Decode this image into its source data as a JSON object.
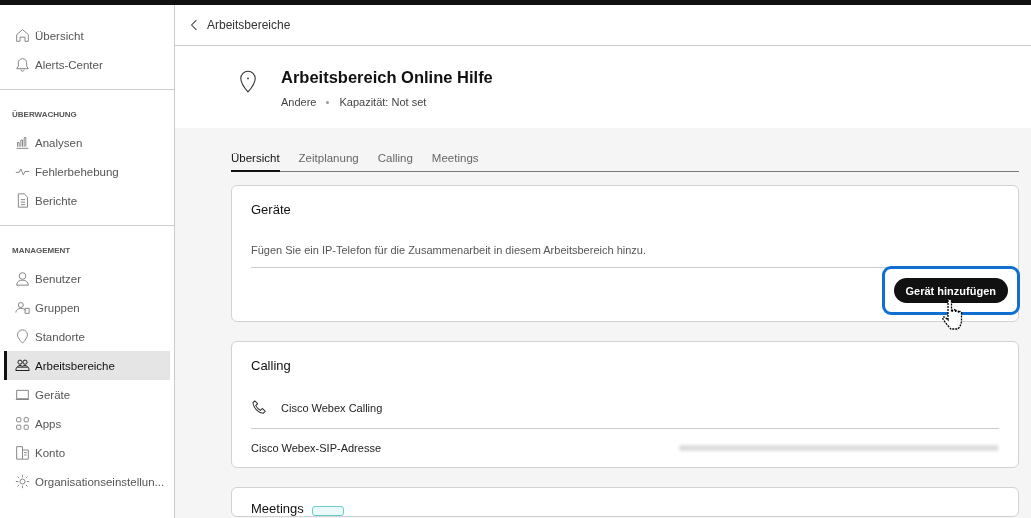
{
  "sidebar": {
    "sections": [
      {
        "items": [
          {
            "label": "Übersicht",
            "selected": false
          },
          {
            "label": "Alerts-Center",
            "selected": false
          }
        ]
      },
      {
        "heading": "ÜBERWACHUNG",
        "items": [
          {
            "label": "Analysen",
            "selected": false
          },
          {
            "label": "Fehlerbehebung",
            "selected": false
          },
          {
            "label": "Berichte",
            "selected": false
          }
        ]
      },
      {
        "heading": "MANAGEMENT",
        "items": [
          {
            "label": "Benutzer",
            "selected": false
          },
          {
            "label": "Gruppen",
            "selected": false
          },
          {
            "label": "Standorte",
            "selected": false
          },
          {
            "label": "Arbeitsbereiche",
            "selected": true
          },
          {
            "label": "Geräte",
            "selected": false
          },
          {
            "label": "Apps",
            "selected": false
          },
          {
            "label": "Konto",
            "selected": false
          },
          {
            "label": "Organisationseinstellun...",
            "selected": false
          }
        ]
      }
    ]
  },
  "breadcrumb": {
    "back_label": "Arbeitsbereiche"
  },
  "header": {
    "title": "Arbeitsbereich Online Hilfe",
    "type": "Andere",
    "capacity": "Kapazität: Not set"
  },
  "tabs": [
    {
      "label": "Übersicht",
      "selected": true
    },
    {
      "label": "Zeitplanung",
      "selected": false
    },
    {
      "label": "Calling",
      "selected": false
    },
    {
      "label": "Meetings",
      "selected": false
    }
  ],
  "devices_card": {
    "title": "Geräte",
    "description": "Fügen Sie ein IP-Telefon für die Zusammenarbeit in diesem Arbeitsbereich hinzu.",
    "button": "Gerät hinzufügen",
    "focused": true
  },
  "calling_card": {
    "title": "Calling",
    "service": "Cisco Webex Calling",
    "sip_label": "Cisco Webex-SIP-Adresse"
  },
  "meetings_card": {
    "title": "Meetings"
  }
}
